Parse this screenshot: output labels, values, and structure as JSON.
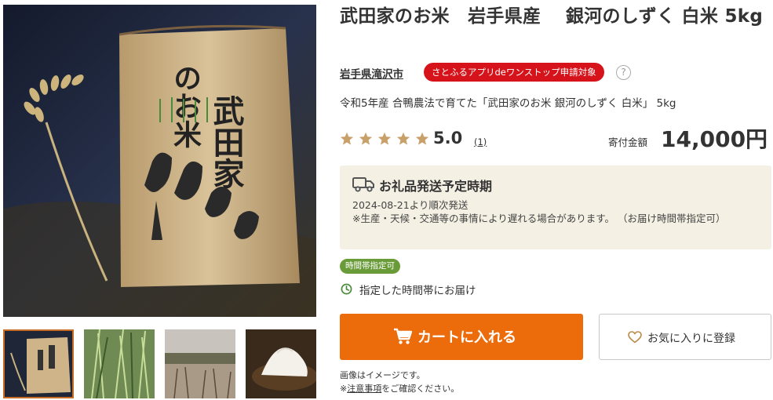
{
  "product": {
    "title": "武田家のお米　岩手県産　 銀河のしずく 白米 5kg",
    "municipality": "岩手県滝沢市",
    "onestop_badge": "さとふるアプリdeワンストップ申請対象",
    "help_label": "?",
    "subtitle": "令和5年産 合鴨農法で育てた「武田家のお米 銀河のしずく 白米」 5kg",
    "bag_text": [
      "武田家",
      "のお米"
    ]
  },
  "rating": {
    "value": "5.0",
    "stars": 5,
    "max_stars": 5,
    "count": "(1)",
    "star_color": "#c8a06a"
  },
  "price": {
    "label": "寄付金額",
    "value": "14,000円"
  },
  "shipping": {
    "icon": "truck-icon",
    "title": "お礼品発送予定時期",
    "date": "2024-08-21より順次発送",
    "note": "※生産・天候・交通等の事情により遅れる場合があります。 （お届け時間帯指定可）"
  },
  "delivery": {
    "badge": "時間帯指定可",
    "icon": "clock-icon",
    "text": "指定した時間帯にお届け"
  },
  "actions": {
    "cart_label": "カートに入れる",
    "cart_icon": "cart-icon",
    "favorite_label": "お気に入りに登録",
    "favorite_icon": "heart-icon"
  },
  "notes": {
    "image_note": "画像はイメージです。",
    "confirm_prefix": "※",
    "confirm_link": "注意事項",
    "confirm_suffix": "をご確認ください。"
  },
  "gallery": {
    "thumbnails": [
      "rice-bag",
      "rice-seedlings",
      "rice-field",
      "cooked-rice"
    ],
    "active_index": 0
  },
  "colors": {
    "accent_orange": "#ec6c0c",
    "badge_red": "#d6121a",
    "badge_green": "#6a9b39",
    "info_box": "#f4f0e3",
    "icon_green": "#4a8a3a"
  }
}
